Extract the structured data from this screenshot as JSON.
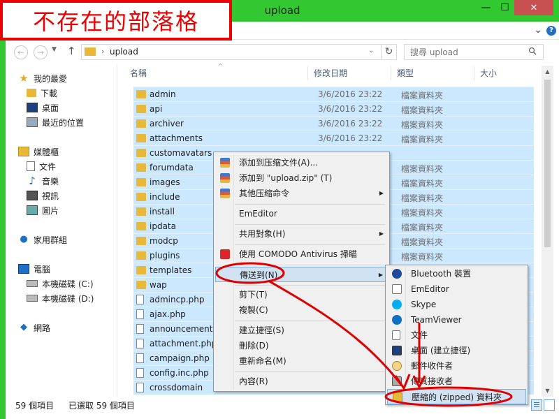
{
  "watermark": "不存在的部落格",
  "window": {
    "title": "upload",
    "minimize_label": "—",
    "maximize_label": "☐",
    "close_label": "✕"
  },
  "address": {
    "path": "upload",
    "search_placeholder": "搜尋 upload"
  },
  "nav": {
    "favorites": "我的最愛",
    "downloads": "下載",
    "desktop": "桌面",
    "recent": "最近的位置",
    "libraries": "媒體櫃",
    "documents": "文件",
    "music": "音樂",
    "videos": "視訊",
    "pictures": "圖片",
    "homegroup": "家用群組",
    "computer": "電腦",
    "drive_c": "本機磁碟 (C:)",
    "drive_d": "本機磁碟 (D:)",
    "network": "網路"
  },
  "columns": {
    "name": "名稱",
    "date": "修改日期",
    "type": "類型",
    "size": "大小"
  },
  "files": [
    {
      "name": "admin",
      "date": "3/6/2016 23:22",
      "type": "檔案資料夾",
      "kind": "folder"
    },
    {
      "name": "api",
      "date": "3/6/2016 23:22",
      "type": "檔案資料夾",
      "kind": "folder"
    },
    {
      "name": "archiver",
      "date": "3/6/2016 23:22",
      "type": "檔案資料夾",
      "kind": "folder"
    },
    {
      "name": "attachments",
      "date": "3/6/2016 23:22",
      "type": "檔案資料夾",
      "kind": "folder"
    },
    {
      "name": "customavatars",
      "date": "",
      "type": "",
      "kind": "folder"
    },
    {
      "name": "forumdata",
      "date": "",
      "type": "檔案資料夾",
      "kind": "folder"
    },
    {
      "name": "images",
      "date": "",
      "type": "檔案資料夾",
      "kind": "folder"
    },
    {
      "name": "include",
      "date": "",
      "type": "檔案資料夾",
      "kind": "folder"
    },
    {
      "name": "install",
      "date": "",
      "type": "檔案資料夾",
      "kind": "folder"
    },
    {
      "name": "ipdata",
      "date": "",
      "type": "檔案資料夾",
      "kind": "folder"
    },
    {
      "name": "modcp",
      "date": "",
      "type": "檔案資料夾",
      "kind": "folder"
    },
    {
      "name": "plugins",
      "date": "",
      "type": "檔案資料夾",
      "kind": "folder"
    },
    {
      "name": "templates",
      "date": "",
      "type": "",
      "kind": "folder"
    },
    {
      "name": "wap",
      "date": "",
      "type": "",
      "kind": "folder"
    },
    {
      "name": "admincp.php",
      "date": "",
      "type": "",
      "kind": "file"
    },
    {
      "name": "ajax.php",
      "date": "",
      "type": "",
      "kind": "file"
    },
    {
      "name": "announcement.php",
      "date": "",
      "type": "",
      "kind": "file"
    },
    {
      "name": "attachment.php",
      "date": "",
      "type": "",
      "kind": "file"
    },
    {
      "name": "campaign.php",
      "date": "",
      "type": "",
      "kind": "file"
    },
    {
      "name": "config.inc.php",
      "date": "",
      "type": "",
      "kind": "file"
    },
    {
      "name": "crossdomain",
      "date": "",
      "type": "",
      "kind": "file"
    }
  ],
  "status": {
    "count": "59 個項目",
    "selected": "已選取 59 個項目"
  },
  "context_menu": {
    "add_archive": "添加到压缩文件(A)...",
    "add_zip": "添加到 \"upload.zip\" (T)",
    "other_compress": "其他压缩命令",
    "emeditor": "EmEditor",
    "share": "共用對象(H)",
    "comodo": "使用 COMODO Antivirus 掃瞄",
    "send_to": "傳送到(N)",
    "cut": "剪下(T)",
    "copy": "複製(C)",
    "shortcut": "建立捷徑(S)",
    "delete": "刪除(D)",
    "rename": "重新命名(M)",
    "properties": "內容(R)"
  },
  "sendto_menu": {
    "bluetooth": "Bluetooth 裝置",
    "emeditor": "EmEditor",
    "skype": "Skype",
    "teamviewer": "TeamViewer",
    "documents": "文件",
    "desktop": "桌面 (建立捷徑)",
    "mail": "郵件收件者",
    "fax": "傳真接收者",
    "zip": "壓縮的 (zipped) 資料夾"
  },
  "colors": {
    "titlebar": "#32c832",
    "selection": "#cce8ff",
    "annotation": "#e00000"
  }
}
